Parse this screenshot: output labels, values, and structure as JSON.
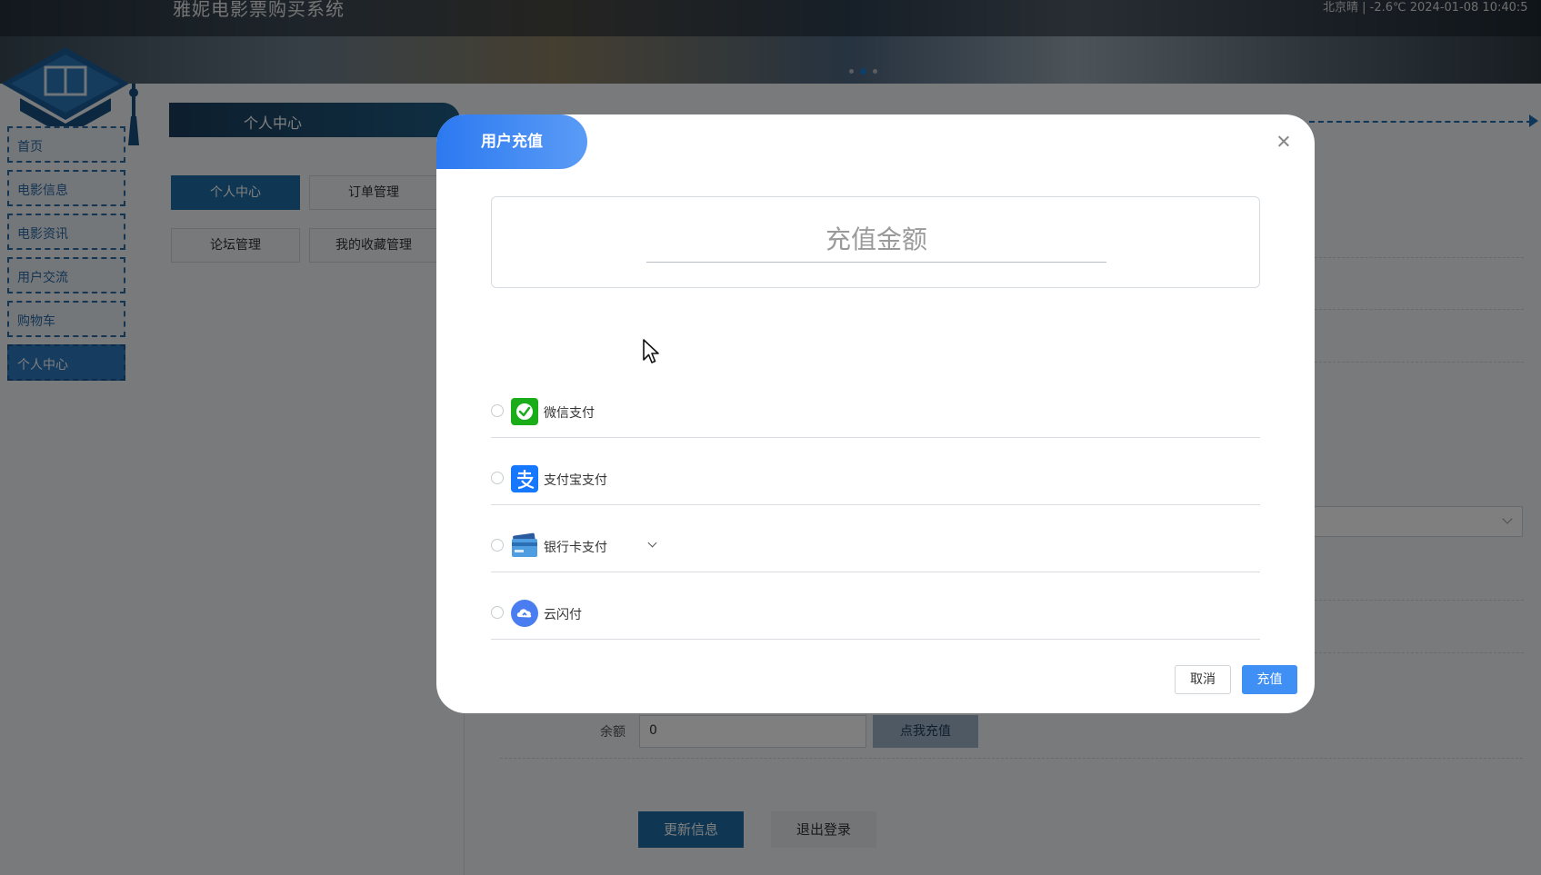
{
  "header": {
    "site_title": "雅妮电影票购买系统",
    "weather_datetime": "北京晴 | -2.6℃   2024-01-08  10:40:5"
  },
  "sidebar": {
    "items": [
      {
        "label": "首页"
      },
      {
        "label": "电影信息"
      },
      {
        "label": "电影资讯"
      },
      {
        "label": "用户交流"
      },
      {
        "label": "购物车"
      },
      {
        "label": "个人中心"
      }
    ]
  },
  "section": {
    "title": "个人中心"
  },
  "sub_tabs": [
    {
      "label": "个人中心"
    },
    {
      "label": "订单管理"
    },
    {
      "label": "论坛管理"
    },
    {
      "label": "我的收藏管理"
    }
  ],
  "profile_form": {
    "balance_label": "余额",
    "balance_value": "0",
    "recharge_link": "点我充值",
    "update_button": "更新信息",
    "logout_button": "退出登录"
  },
  "modal": {
    "title": "用户充值",
    "amount_placeholder": "充值金额",
    "payment_methods": [
      {
        "label": "微信支付",
        "icon": "wechat-pay-icon",
        "color": "#1aad19"
      },
      {
        "label": "支付宝支付",
        "icon": "alipay-icon",
        "color": "#1677ff"
      },
      {
        "label": "银行卡支付",
        "icon": "bank-card-icon",
        "color": "#3a7bd5"
      },
      {
        "label": "云闪付",
        "icon": "unionpay-cloud-icon",
        "color": "#4a7ef0"
      }
    ],
    "cancel_button": "取消",
    "submit_button": "充值"
  },
  "colors": {
    "primary": "#1f6fa6",
    "modal_accent": "#3f8ff5"
  }
}
